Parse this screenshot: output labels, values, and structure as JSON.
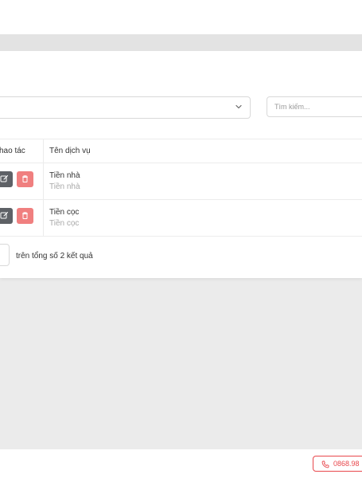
{
  "filters": {
    "service_select_value": "",
    "search_placeholder": "Tìm kiếm..."
  },
  "table": {
    "headers": {
      "actions": "hao tác",
      "service_name": "Tên dịch vụ"
    },
    "rows": [
      {
        "name": "Tiền nhà",
        "subtitle": "Tiền nhà"
      },
      {
        "name": "Tiền cọc",
        "subtitle": "Tiền cọc"
      }
    ]
  },
  "pagination": {
    "total_text": "trên tổng số 2 kết quả"
  },
  "footer": {
    "phone": "0868.98"
  },
  "icons": {
    "select_chevron": "chevron-down-icon",
    "edit": "edit-icon",
    "delete": "trash-icon",
    "phone": "phone-icon"
  },
  "colors": {
    "edit_button": "#5e6166",
    "delete_button": "#f07f7f",
    "phone_accent": "#e8474c",
    "page_background": "#ebebeb"
  }
}
